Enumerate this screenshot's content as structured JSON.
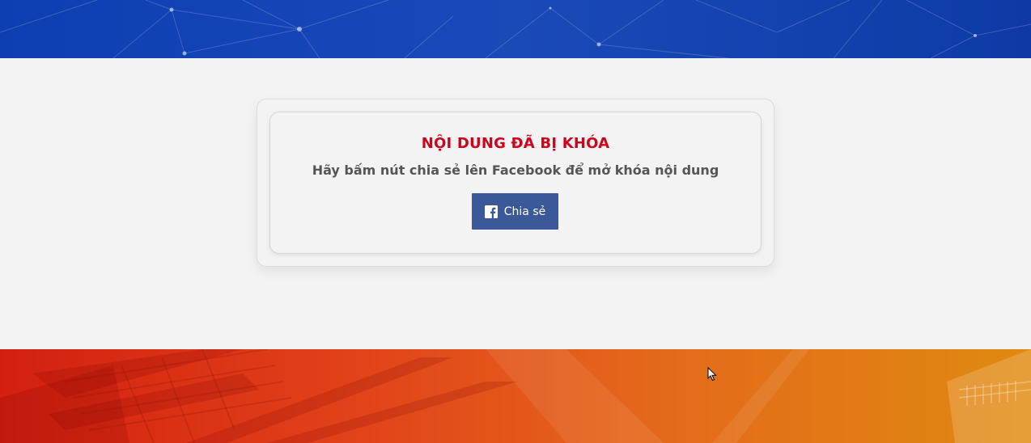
{
  "lock_box": {
    "title": "NỘI DUNG ĐÃ BỊ KHÓA",
    "message": "Hãy bấm nút chia sẻ lên Facebook để mở khóa nội dung",
    "share_button_label": "Chia sẻ"
  },
  "colors": {
    "title_red": "#d0021b",
    "facebook_blue": "#3b5998",
    "top_banner_blue": "#1a49b8",
    "bottom_banner_orange": "#e46a1b"
  },
  "icons": {
    "share_icon": "facebook-icon"
  }
}
